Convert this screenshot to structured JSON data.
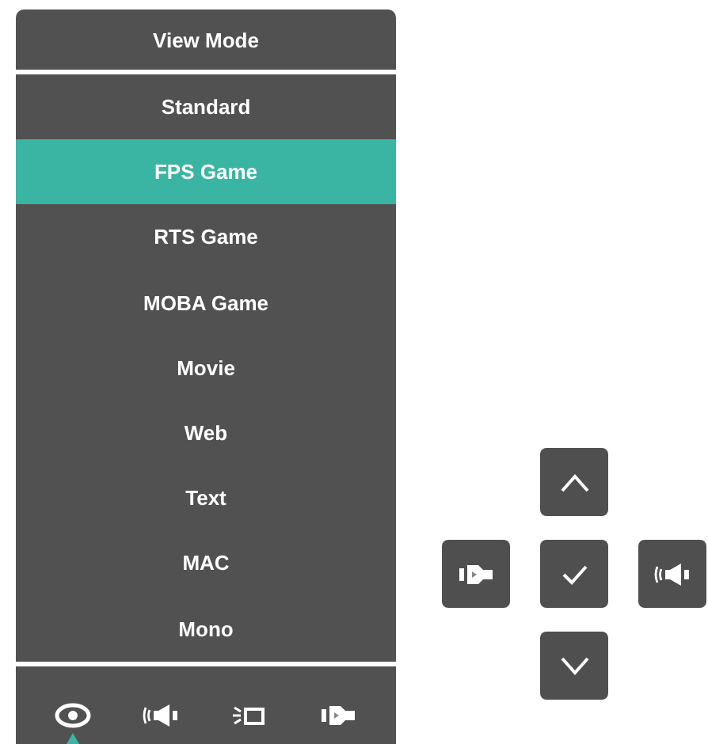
{
  "menu": {
    "title": "View Mode",
    "items": [
      {
        "label": "Standard",
        "selected": false
      },
      {
        "label": "FPS Game",
        "selected": true
      },
      {
        "label": "RTS Game",
        "selected": false
      },
      {
        "label": "MOBA Game",
        "selected": false
      },
      {
        "label": "Movie",
        "selected": false
      },
      {
        "label": "Web",
        "selected": false
      },
      {
        "label": "Text",
        "selected": false
      },
      {
        "label": "MAC",
        "selected": false
      },
      {
        "label": "Mono",
        "selected": false
      }
    ]
  },
  "tabs": [
    {
      "kind": "eye",
      "selected": true
    },
    {
      "kind": "audio",
      "selected": false
    },
    {
      "kind": "light",
      "selected": false
    },
    {
      "kind": "input",
      "selected": false
    }
  ]
}
